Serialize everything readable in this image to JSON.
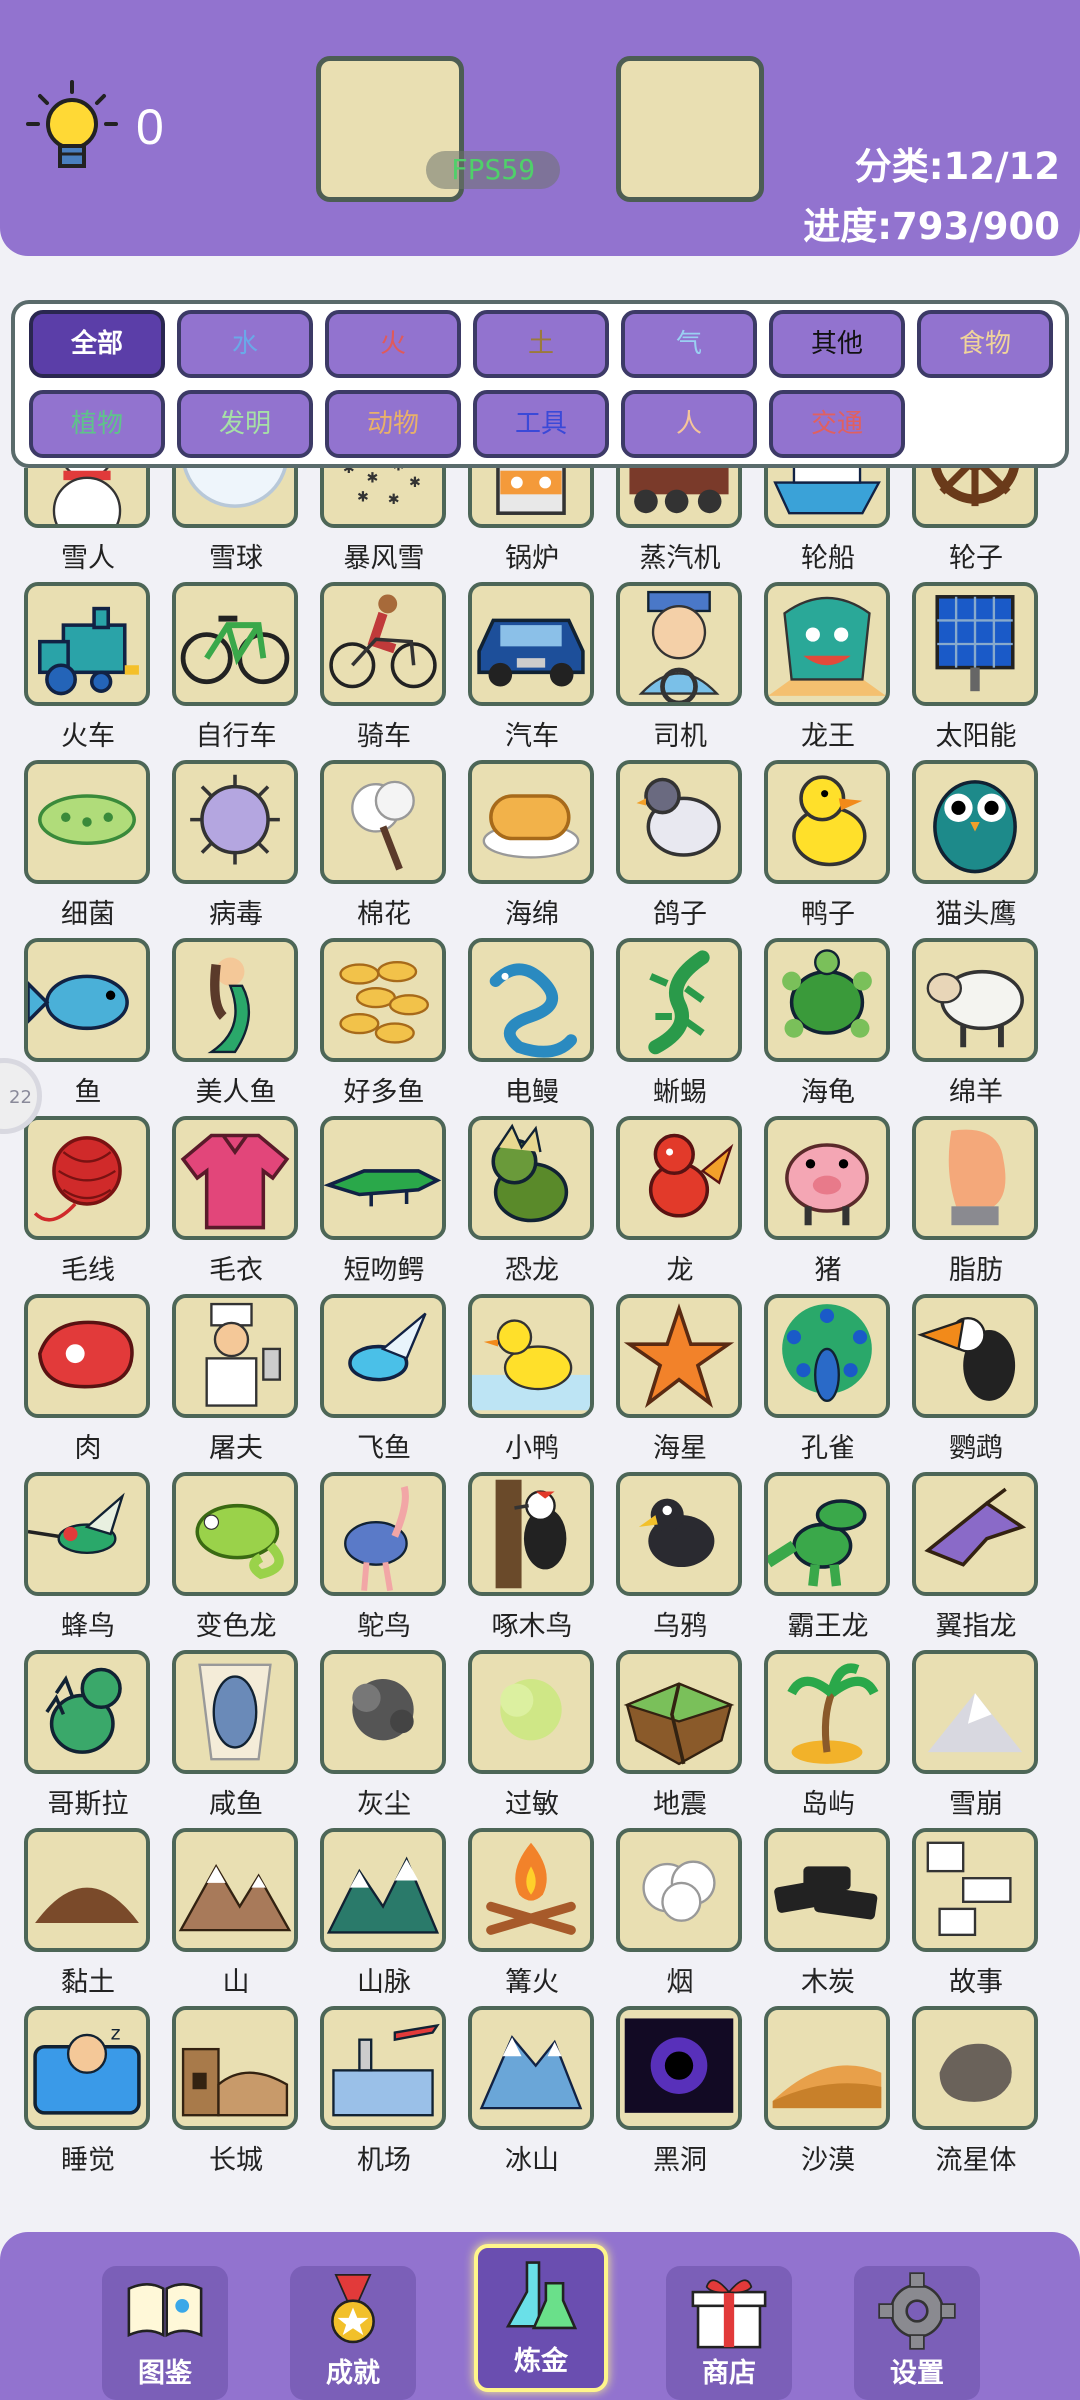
{
  "header": {
    "hint_count": "0",
    "fps": "FPS59",
    "category_text": "分类:12/12",
    "progress_text": "进度:793/900"
  },
  "side_handle": "22",
  "filters": [
    {
      "label": "全部",
      "color": "#ffffff",
      "active": true
    },
    {
      "label": "水",
      "color": "#6aa9e8"
    },
    {
      "label": "火",
      "color": "#e05a5a"
    },
    {
      "label": "土",
      "color": "#9b7a3a"
    },
    {
      "label": "气",
      "color": "#9ad0f2"
    },
    {
      "label": "其他",
      "color": "#111111"
    },
    {
      "label": "食物",
      "color": "#f0d49a"
    },
    {
      "label": "植物",
      "color": "#5ec48a"
    },
    {
      "label": "发明",
      "color": "#a6e0a6"
    },
    {
      "label": "动物",
      "color": "#e8b06a"
    },
    {
      "label": "工具",
      "color": "#3a49d8"
    },
    {
      "label": "人",
      "color": "#f5c59a"
    },
    {
      "label": "交通",
      "color": "#e06060"
    }
  ],
  "items": [
    {
      "label": "雪人",
      "icon": "snowman-icon"
    },
    {
      "label": "雪球",
      "icon": "snowball-icon"
    },
    {
      "label": "暴风雪",
      "icon": "blizzard-icon"
    },
    {
      "label": "锅炉",
      "icon": "boiler-icon"
    },
    {
      "label": "蒸汽机",
      "icon": "steam-engine-icon"
    },
    {
      "label": "轮船",
      "icon": "ship-icon"
    },
    {
      "label": "轮子",
      "icon": "wheel-icon"
    },
    {
      "label": "火车",
      "icon": "train-icon"
    },
    {
      "label": "自行车",
      "icon": "bicycle-icon"
    },
    {
      "label": "骑车",
      "icon": "cyclist-icon"
    },
    {
      "label": "汽车",
      "icon": "car-icon"
    },
    {
      "label": "司机",
      "icon": "driver-icon"
    },
    {
      "label": "龙王",
      "icon": "dragon-king-icon"
    },
    {
      "label": "太阳能",
      "icon": "solar-panel-icon"
    },
    {
      "label": "细菌",
      "icon": "bacteria-icon"
    },
    {
      "label": "病毒",
      "icon": "virus-icon"
    },
    {
      "label": "棉花",
      "icon": "cotton-icon"
    },
    {
      "label": "海绵",
      "icon": "sponge-icon"
    },
    {
      "label": "鸽子",
      "icon": "pigeon-icon"
    },
    {
      "label": "鸭子",
      "icon": "duck-icon"
    },
    {
      "label": "猫头鹰",
      "icon": "owl-icon"
    },
    {
      "label": "鱼",
      "icon": "fish-icon"
    },
    {
      "label": "美人鱼",
      "icon": "mermaid-icon"
    },
    {
      "label": "好多鱼",
      "icon": "many-fish-icon"
    },
    {
      "label": "电鳗",
      "icon": "eel-icon"
    },
    {
      "label": "蜥蜴",
      "icon": "lizard-icon"
    },
    {
      "label": "海龟",
      "icon": "turtle-icon"
    },
    {
      "label": "绵羊",
      "icon": "sheep-icon"
    },
    {
      "label": "毛线",
      "icon": "yarn-icon"
    },
    {
      "label": "毛衣",
      "icon": "sweater-icon"
    },
    {
      "label": "短吻鳄",
      "icon": "alligator-icon"
    },
    {
      "label": "恐龙",
      "icon": "dinosaur-icon"
    },
    {
      "label": "龙",
      "icon": "dragon-icon"
    },
    {
      "label": "猪",
      "icon": "pig-icon"
    },
    {
      "label": "脂肪",
      "icon": "fat-icon"
    },
    {
      "label": "肉",
      "icon": "meat-icon"
    },
    {
      "label": "屠夫",
      "icon": "butcher-icon"
    },
    {
      "label": "飞鱼",
      "icon": "flying-fish-icon"
    },
    {
      "label": "小鸭",
      "icon": "duckling-icon"
    },
    {
      "label": "海星",
      "icon": "starfish-icon"
    },
    {
      "label": "孔雀",
      "icon": "peacock-icon"
    },
    {
      "label": "鹦鹉",
      "icon": "toucan-icon"
    },
    {
      "label": "蜂鸟",
      "icon": "hummingbird-icon"
    },
    {
      "label": "变色龙",
      "icon": "chameleon-icon"
    },
    {
      "label": "鸵鸟",
      "icon": "ostrich-icon"
    },
    {
      "label": "啄木鸟",
      "icon": "woodpecker-icon"
    },
    {
      "label": "乌鸦",
      "icon": "crow-icon"
    },
    {
      "label": "霸王龙",
      "icon": "t-rex-icon"
    },
    {
      "label": "翼指龙",
      "icon": "pterodactyl-icon"
    },
    {
      "label": "哥斯拉",
      "icon": "godzilla-icon"
    },
    {
      "label": "咸鱼",
      "icon": "salted-fish-icon"
    },
    {
      "label": "灰尘",
      "icon": "dust-icon"
    },
    {
      "label": "过敏",
      "icon": "allergy-icon"
    },
    {
      "label": "地震",
      "icon": "earthquake-icon"
    },
    {
      "label": "岛屿",
      "icon": "island-icon"
    },
    {
      "label": "雪崩",
      "icon": "avalanche-icon"
    },
    {
      "label": "黏土",
      "icon": "clay-icon"
    },
    {
      "label": "山",
      "icon": "mountain-icon"
    },
    {
      "label": "山脉",
      "icon": "mountain-range-icon"
    },
    {
      "label": "篝火",
      "icon": "campfire-icon"
    },
    {
      "label": "烟",
      "icon": "smoke-icon"
    },
    {
      "label": "木炭",
      "icon": "charcoal-icon"
    },
    {
      "label": "故事",
      "icon": "story-icon"
    },
    {
      "label": "睡觉",
      "icon": "sleep-icon"
    },
    {
      "label": "长城",
      "icon": "great-wall-icon"
    },
    {
      "label": "机场",
      "icon": "airport-icon"
    },
    {
      "label": "冰山",
      "icon": "iceberg-icon"
    },
    {
      "label": "黑洞",
      "icon": "black-hole-icon"
    },
    {
      "label": "沙漠",
      "icon": "desert-icon"
    },
    {
      "label": "流星体",
      "icon": "meteoroid-icon"
    }
  ],
  "nav": [
    {
      "label": "图鉴",
      "icon": "encyclopedia-icon"
    },
    {
      "label": "成就",
      "icon": "achievement-medal-icon"
    },
    {
      "label": "炼金",
      "icon": "alchemy-flask-icon",
      "active": true
    },
    {
      "label": "商店",
      "icon": "gift-shop-icon"
    },
    {
      "label": "设置",
      "icon": "settings-gear-icon"
    }
  ]
}
